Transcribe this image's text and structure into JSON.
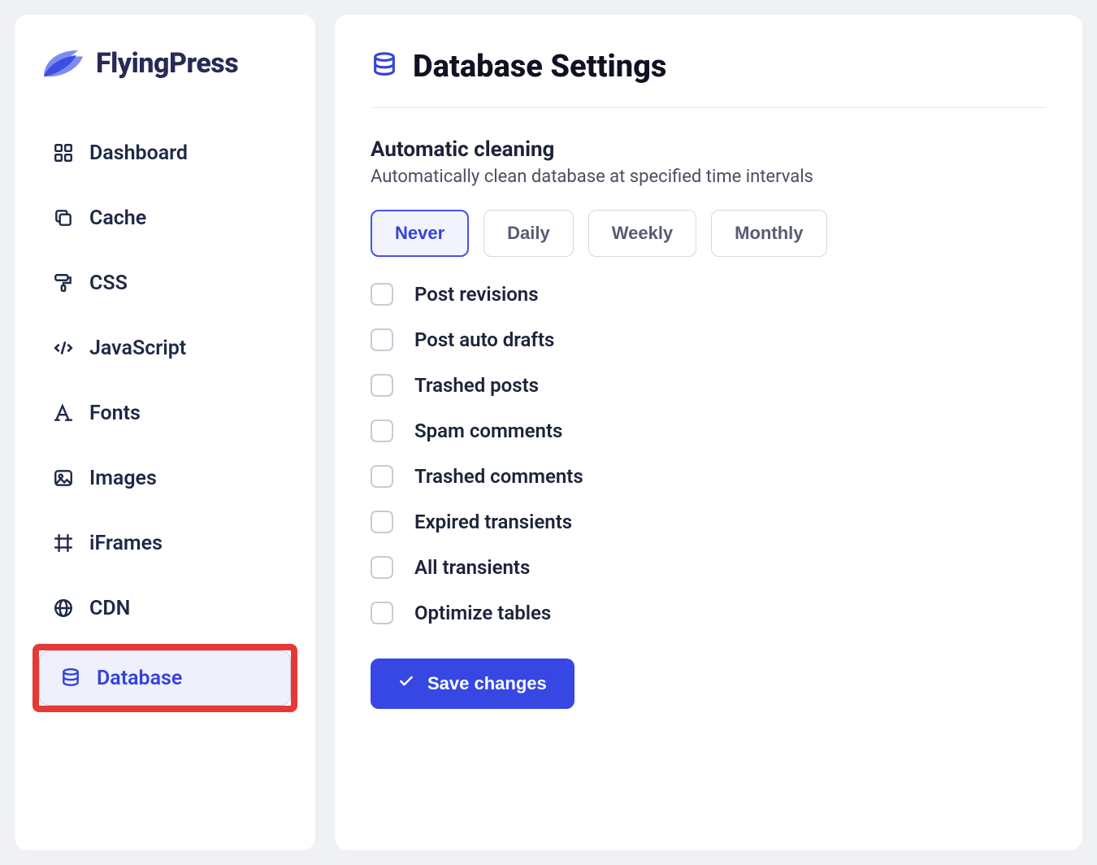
{
  "brand": "FlyingPress",
  "sidebar": {
    "items": [
      {
        "label": "Dashboard",
        "icon": "grid-icon",
        "active": false
      },
      {
        "label": "Cache",
        "icon": "copy-icon",
        "active": false
      },
      {
        "label": "CSS",
        "icon": "paint-roller-icon",
        "active": false
      },
      {
        "label": "JavaScript",
        "icon": "code-icon",
        "active": false
      },
      {
        "label": "Fonts",
        "icon": "font-icon",
        "active": false
      },
      {
        "label": "Images",
        "icon": "image-icon",
        "active": false
      },
      {
        "label": "iFrames",
        "icon": "frame-icon",
        "active": false
      },
      {
        "label": "CDN",
        "icon": "globe-icon",
        "active": false
      },
      {
        "label": "Database",
        "icon": "database-icon",
        "active": true,
        "highlighted": true
      }
    ]
  },
  "page": {
    "title": "Database Settings",
    "section_title": "Automatic cleaning",
    "section_sub": "Automatically clean database at specified time intervals",
    "intervals": [
      {
        "label": "Never",
        "active": true
      },
      {
        "label": "Daily",
        "active": false
      },
      {
        "label": "Weekly",
        "active": false
      },
      {
        "label": "Monthly",
        "active": false
      }
    ],
    "checkboxes": [
      {
        "label": "Post revisions",
        "checked": false
      },
      {
        "label": "Post auto drafts",
        "checked": false
      },
      {
        "label": "Trashed posts",
        "checked": false
      },
      {
        "label": "Spam comments",
        "checked": false
      },
      {
        "label": "Trashed comments",
        "checked": false
      },
      {
        "label": "Expired transients",
        "checked": false
      },
      {
        "label": "All transients",
        "checked": false
      },
      {
        "label": "Optimize tables",
        "checked": false
      }
    ],
    "save_label": "Save changes"
  }
}
